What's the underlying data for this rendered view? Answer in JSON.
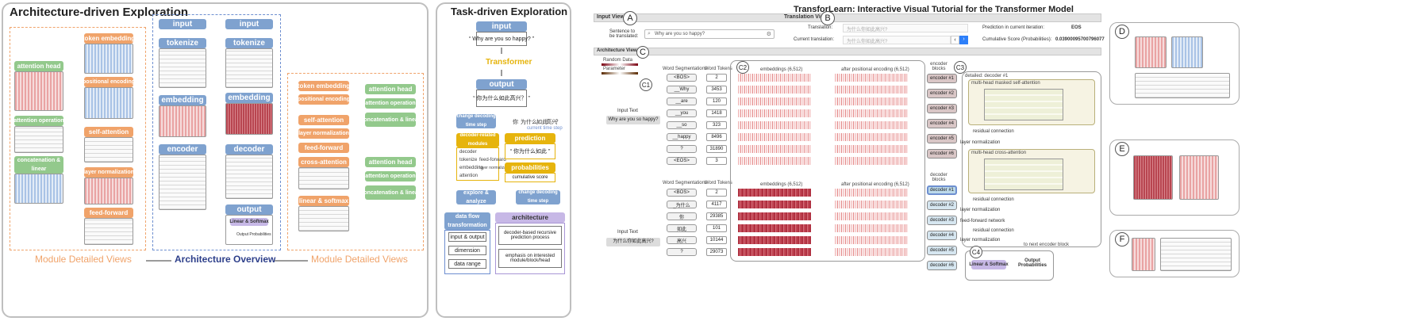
{
  "left": {
    "title": "Architecture-driven Exploration",
    "module_views_label": "Module Detailed Views",
    "overview_label": "Architecture Overview",
    "module_views_label_right": "Module Detailed Views",
    "encoder_column": [
      "input",
      "tokenize",
      "embedding",
      "encoder"
    ],
    "decoder_column": [
      "input",
      "tokenize",
      "embedding",
      "decoder",
      "output"
    ],
    "output_sub": "Linear & Softmax",
    "output_probs": "Output Probabilities",
    "left_modules": [
      "token embedding",
      "positional encoding",
      "self-attention",
      "layer normalization",
      "feed-forward"
    ],
    "left_sub": [
      "attention head",
      "attention operation",
      "concatenation & linear"
    ],
    "right_modules": [
      "token embedding",
      "positional encoding",
      "self-attention",
      "layer normalization",
      "feed-forward",
      "cross-attention",
      "linear & softmax"
    ],
    "right_sub_top": [
      "attention head",
      "attention operation",
      "concatenation & linear"
    ],
    "right_sub_bottom": [
      "attention head",
      "attention operation",
      "concatenation & linear"
    ]
  },
  "middle": {
    "title": "Task-driven Exploration",
    "input_label": "input",
    "input_text": "“ Why are you so happy? ”",
    "transformer_label": "Transformer",
    "output_label": "output",
    "output_text": "“ 你为什么如此高兴？ ”",
    "change_step": "change decoding time step",
    "sequence": [
      "你",
      "为什么",
      "如此",
      "高兴",
      "？"
    ],
    "current_time": "current time step",
    "decoder_modules": "decoder-related modules",
    "decoder_items": [
      "decoder",
      "tokenize",
      "feed-forward",
      "embedding",
      "layer normalization",
      "attention"
    ],
    "prediction": "prediction",
    "prediction_text": "“ 你为什么如此 ”",
    "probabilities": "probabilities",
    "cumulative": "cumulative score",
    "explore": "explore & analyze",
    "change_step2": "change decoding time step",
    "data_flow": "data flow transformation",
    "data_flow_items": [
      "input & output",
      "dimension",
      "data range"
    ],
    "architecture": "architecture",
    "architecture_items": [
      "decoder-based recursive prediction process",
      "emphasis on interested module/block/head"
    ]
  },
  "right": {
    "title": "TransforLearn: Interactive Visual Tutorial for the Transformer Model",
    "input_view": "Input View",
    "translation_view": "Translation View",
    "sentence_label": "Sentence to be translated:",
    "sentence_value": "Why are you so happy?",
    "translation_label": "Translation:",
    "translation_value": "为什么你如此高兴?",
    "current_translation_label": "Current translation:",
    "current_translation_value": "为什么你如此高兴?",
    "prediction_label": "Prediction in current iteration:",
    "prediction_value": "EOS",
    "score_label": "Cumulative Score (Probabilities):",
    "score_value": "0.03900095700796077",
    "architecture_view": "Architecture View",
    "tags": [
      "A",
      "B",
      "C",
      "C1",
      "C2",
      "C3",
      "C4",
      "D",
      "E",
      "F"
    ],
    "input_text_label": "Input Text",
    "input_text_value": "Why are you so happy?",
    "input_text_value2": "为什么你如此高兴?",
    "seg_label": "Word Segmentations",
    "tok_label": "Word Tokens",
    "enc_words": [
      "<BOS>",
      "__Why",
      "__are",
      "__you",
      "__so",
      "__happy",
      "?",
      "<EOS>"
    ],
    "enc_tokens": [
      "2",
      "3453",
      "120",
      "1418",
      "323",
      "8496",
      "31890",
      "3"
    ],
    "dec_words": [
      "<BOS>",
      "_为什么",
      "你",
      "如此",
      "高兴",
      "?"
    ],
    "dec_tokens": [
      "2",
      "4117",
      "29385",
      "101",
      "10144",
      "29073"
    ],
    "emb_label": "embeddings (6,512)",
    "pos_label": "after positional encoding (6,512)",
    "encoder_blocks": "encoder blocks",
    "decoder_blocks": "decoder blocks",
    "encoders": [
      "encoder #1",
      "encoder #2",
      "encoder #3",
      "encoder #4",
      "encoder #5",
      "encoder #6"
    ],
    "decoders": [
      "decoder #1",
      "decoder #2",
      "decoder #3",
      "decoder #4",
      "decoder #5",
      "decoder #6"
    ],
    "detailed": "detailed: decoder #1",
    "mmsa": "multi-head masked self-attention",
    "mhca": "multi-head cross-attention",
    "residual": "residual connection",
    "layer_norm": "layer normalization",
    "feed_forward": "feed-forward network",
    "next_block": "to next encoder block",
    "linear_softmax": "Linear & Softmax",
    "output_probs": "Output Probabilities",
    "legend": [
      "Random Data",
      "Parameter"
    ]
  }
}
